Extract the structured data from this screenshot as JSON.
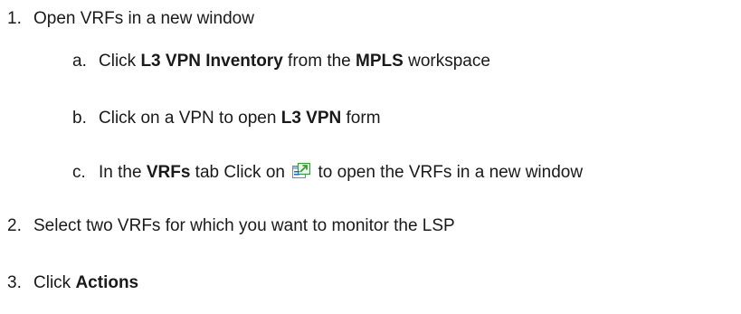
{
  "steps": [
    {
      "number": "1.",
      "text": "Open VRFs in a new window",
      "substeps": [
        {
          "letter": "a.",
          "parts": [
            "Click ",
            "L3 VPN Inventory",
            " from the ",
            "MPLS",
            " workspace"
          ]
        },
        {
          "letter": "b.",
          "parts": [
            "Click on a VPN to open ",
            "L3 VPN",
            " form"
          ]
        },
        {
          "letter": "c.",
          "parts": [
            "In the ",
            "VRFs",
            " tab Click on ",
            " to open the VRFs in a new window"
          ],
          "icon": "open-in-new-window-icon"
        }
      ]
    },
    {
      "number": "2.",
      "text": "Select two VRFs for which you want to monitor the LSP"
    },
    {
      "number": "3.",
      "parts": [
        "Click ",
        "Actions"
      ]
    }
  ],
  "colors": {
    "text": "#1a1a1a",
    "icon_green": "#3a9a3a",
    "icon_blue": "#2c66b8",
    "icon_frame": "#7a8a9a"
  }
}
